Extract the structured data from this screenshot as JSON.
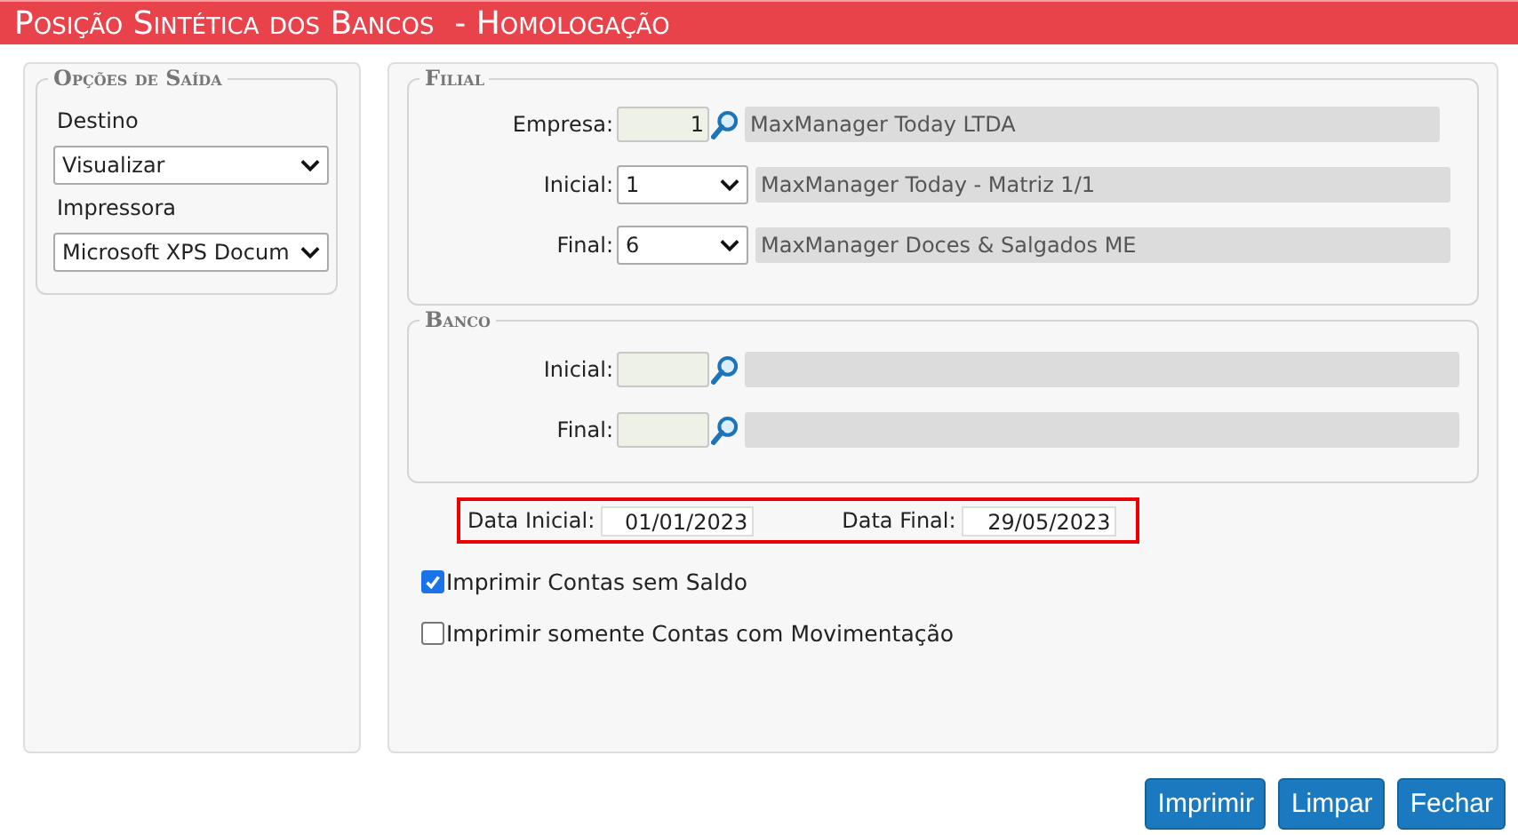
{
  "title": "Posição Sintética dos Bancos  - Homologação",
  "output_options": {
    "legend": "Opções de Saída",
    "fields": [
      {
        "label": "Destino",
        "value": "Visualizar"
      },
      {
        "label": "Impressora",
        "value": "Microsoft XPS Docum"
      }
    ]
  },
  "filial": {
    "legend": "Filial",
    "rows": [
      {
        "label": "Empresa:",
        "kind": "lookup",
        "code": "1",
        "description": "MaxManager Today LTDA"
      },
      {
        "label": "Inicial:",
        "kind": "select",
        "code": "1",
        "description": "MaxManager Today - Matriz 1/1"
      },
      {
        "label": "Final:",
        "kind": "select",
        "code": "6",
        "description": "MaxManager Doces & Salgados ME"
      }
    ]
  },
  "banco": {
    "legend": "Banco",
    "rows": [
      {
        "label": "Inicial:",
        "kind": "lookup"
      },
      {
        "label": "Final:",
        "kind": "lookup"
      }
    ]
  },
  "dates": [
    {
      "label": "Data Inicial:",
      "value": "01/01/2023"
    },
    {
      "label": "Data Final:",
      "value": "29/05/2023"
    }
  ],
  "checkboxes": [
    {
      "label": "Imprimir Contas sem Saldo",
      "checked": true
    },
    {
      "label": "Imprimir somente Contas com Movimentação",
      "checked": false
    }
  ],
  "buttons": [
    "Imprimir",
    "Limpar",
    "Fechar"
  ]
}
